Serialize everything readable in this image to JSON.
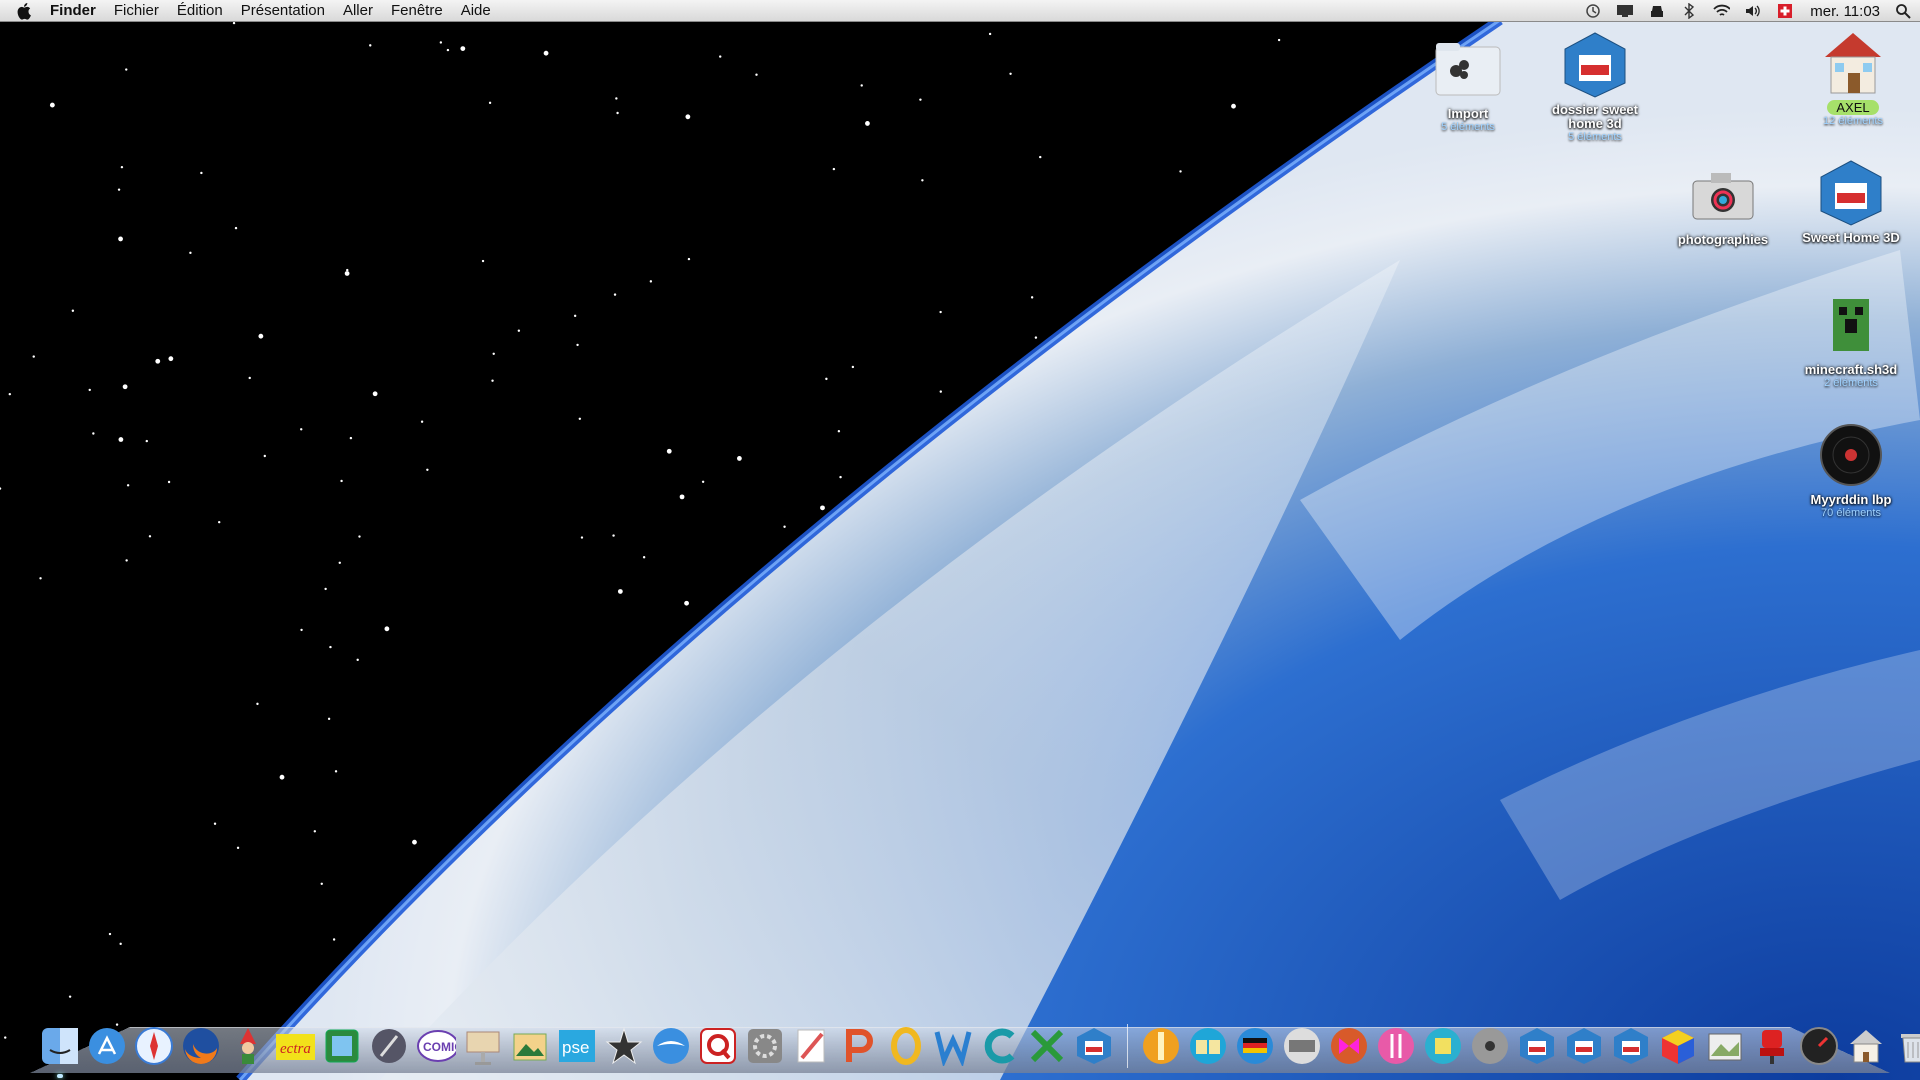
{
  "menubar": {
    "app_name": "Finder",
    "items": [
      "Fichier",
      "Édition",
      "Présentation",
      "Aller",
      "Fenêtre",
      "Aide"
    ],
    "status_icons": [
      "time-machine-icon",
      "display-icon",
      "spy-icon",
      "bluetooth-icon",
      "wifi-icon",
      "volume-icon",
      "flag-ch-icon"
    ],
    "clock": "mer. 11:03"
  },
  "desktop": {
    "icons": [
      {
        "name": "Import",
        "sub": "5 éléments",
        "icon": "folder-icon"
      },
      {
        "name": "dossier sweet home 3d",
        "sub": "5 éléments",
        "icon": "sweet-home-3d-icon"
      },
      {
        "name": "AXEL",
        "sub": "12 éléments",
        "icon": "home-icon"
      },
      {
        "name": "photographies",
        "sub": "",
        "icon": "camera-icon"
      },
      {
        "name": "Sweet Home 3D",
        "sub": "",
        "icon": "sweet-home-3d-icon"
      },
      {
        "name": "minecraft.sh3d",
        "sub": "2 éléments",
        "icon": "minecraft-icon"
      },
      {
        "name": "Myyrddin lbp",
        "sub": "70 éléments",
        "icon": "record-icon"
      }
    ]
  },
  "dock": {
    "apps": [
      "finder-icon",
      "app-store-icon",
      "safari-icon",
      "firefox-icon",
      "gnome-icon",
      "ectra-icon",
      "photo-booth-icon",
      "pen-tool-icon",
      "comic-life-icon",
      "keynote-icon",
      "iphoto-icon",
      "pse-icon",
      "imovie-icon",
      "mail-icon",
      "quicktime-icon",
      "system-prefs-icon",
      "pages-icon",
      "powerpoint-icon",
      "outlook-icon",
      "word-icon",
      "c-app-icon",
      "excel-icon",
      "sweet-home-3d-icon"
    ],
    "docs": [
      "ruler-icon",
      "book-icon",
      "flag-de-icon",
      "keyboard-icon",
      "butterfly-icon",
      "crochet-icon",
      "cube-box-icon",
      "dvd-icon",
      "sh3d-doc-icon",
      "sh3d-doc-icon",
      "sh3d-doc-icon",
      "color-cube-icon",
      "image-capture-icon",
      "chair-icon",
      "dashboard-icon",
      "home-folder-icon",
      "trash-icon"
    ],
    "pse_label": "pse",
    "ectra_label": "ectra",
    "comic_label": "COMIC"
  },
  "colors": {
    "label_green": "#a6e06a",
    "accent_blue": "#2a6fd6"
  }
}
